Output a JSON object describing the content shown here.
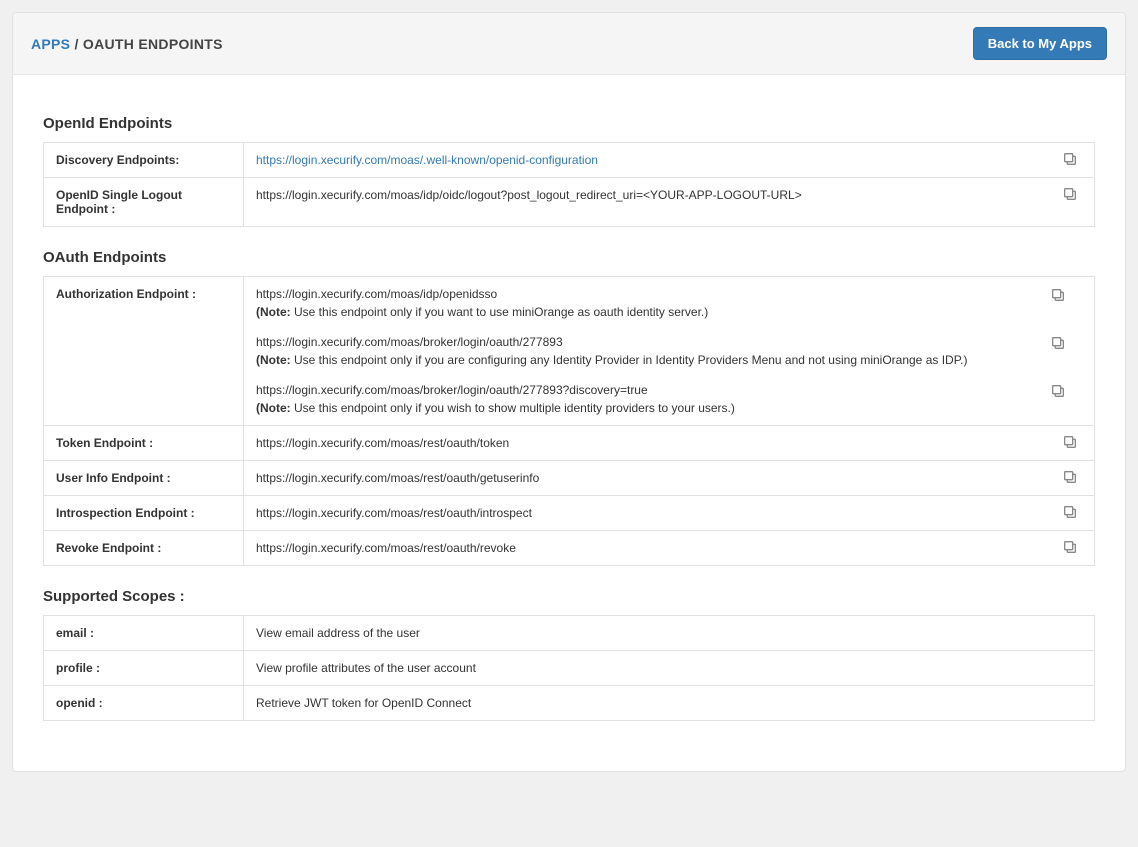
{
  "breadcrumb": {
    "root": "APPS",
    "sep": " / ",
    "current": "OAUTH ENDPOINTS"
  },
  "back_button": "Back to My Apps",
  "sections": {
    "openid": {
      "title": "OpenId Endpoints",
      "discovery_label": "Discovery Endpoints:",
      "discovery_url": "https://login.xecurify.com/moas/.well-known/openid-configuration",
      "slo_label": "OpenID Single Logout Endpoint :",
      "slo_url": "https://login.xecurify.com/moas/idp/oidc/logout?post_logout_redirect_uri=<YOUR-APP-LOGOUT-URL>"
    },
    "oauth": {
      "title": "OAuth Endpoints",
      "authz_label": "Authorization Endpoint :",
      "authz1_url": "https://login.xecurify.com/moas/idp/openidsso",
      "authz1_note_prefix": "(Note:",
      "authz1_note_text": " Use this endpoint only if you want to use miniOrange as oauth identity server.)",
      "authz2_url": "https://login.xecurify.com/moas/broker/login/oauth/277893",
      "authz2_note_prefix": "(Note:",
      "authz2_note_text": " Use this endpoint only if you are configuring any Identity Provider in Identity Providers Menu and not using miniOrange as IDP.)",
      "authz3_url": "https://login.xecurify.com/moas/broker/login/oauth/277893?discovery=true",
      "authz3_note_prefix": "(Note:",
      "authz3_note_text": " Use this endpoint only if you wish to show multiple identity providers to your users.)",
      "token_label": "Token Endpoint :",
      "token_url": "https://login.xecurify.com/moas/rest/oauth/token",
      "userinfo_label": "User Info Endpoint :",
      "userinfo_url": "https://login.xecurify.com/moas/rest/oauth/getuserinfo",
      "introspect_label": "Introspection Endpoint :",
      "introspect_url": "https://login.xecurify.com/moas/rest/oauth/introspect",
      "revoke_label": "Revoke Endpoint :",
      "revoke_url": "https://login.xecurify.com/moas/rest/oauth/revoke"
    },
    "scopes": {
      "title": "Supported Scopes :",
      "email_label": "email :",
      "email_desc": "View email address of the user",
      "profile_label": "profile :",
      "profile_desc": "View profile attributes of the user account",
      "openid_label": "openid :",
      "openid_desc": "Retrieve JWT token for OpenID Connect"
    }
  }
}
